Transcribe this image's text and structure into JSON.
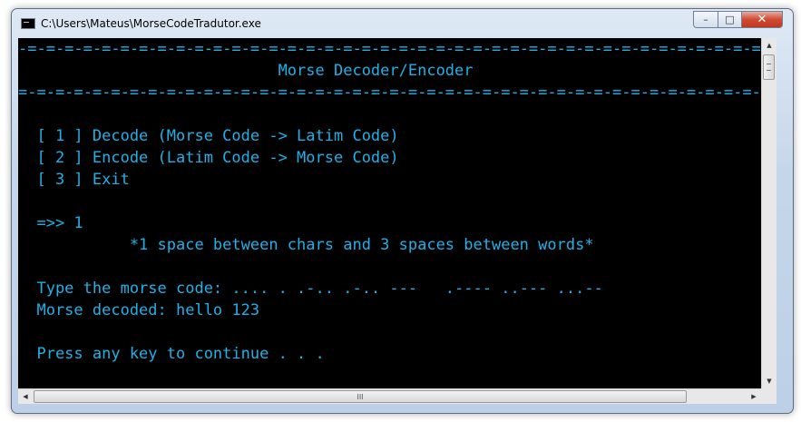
{
  "window": {
    "title": "C:\\Users\\Mateus\\MorseCodeTradutor.exe",
    "controls": {
      "minimize": "–",
      "maximize": "□",
      "close": "✕"
    }
  },
  "console": {
    "colors": {
      "background": "#000000",
      "text": "#1fb1e8"
    },
    "lines": [
      "-=-=-=-=-=-=-=-=-=-=-=-=-=-=-=-=-=-=-=-=-=-=-=-=-=-=-=-=-=-=-=-=-=-=-=-=-=-=-=-=-=-=-=-=-=-=-=-=-=-=-=-=-=-=-=-=-",
      "                            Morse Decoder/Encoder",
      "=-=-=-=-=-=-=-=-=-=-=-=-=-=-=-=-=-=-=-=-=-=-=-=-=-=-=-=-=-=-=-=-=-=-=-=-=-=-=-=-=-=-=-=-=-=-=-=-=-=-=-=-=-=-=-=-=-",
      "",
      "  [ 1 ] Decode (Morse Code -> Latim Code)",
      "  [ 2 ] Encode (Latim Code -> Morse Code)",
      "  [ 3 ] Exit",
      "",
      "  =>> 1",
      "            *1 space between chars and 3 spaces between words*",
      "",
      "  Type the morse code: .... . .-.. .-.. ---   .---- ..--- ...--",
      "  Morse decoded: hello 123",
      "",
      "  Press any key to continue . . ."
    ]
  },
  "scrollbars": {
    "up_arrow": "▲",
    "down_arrow": "▼",
    "left_arrow": "◀",
    "right_arrow": "▶",
    "grip": "III"
  }
}
